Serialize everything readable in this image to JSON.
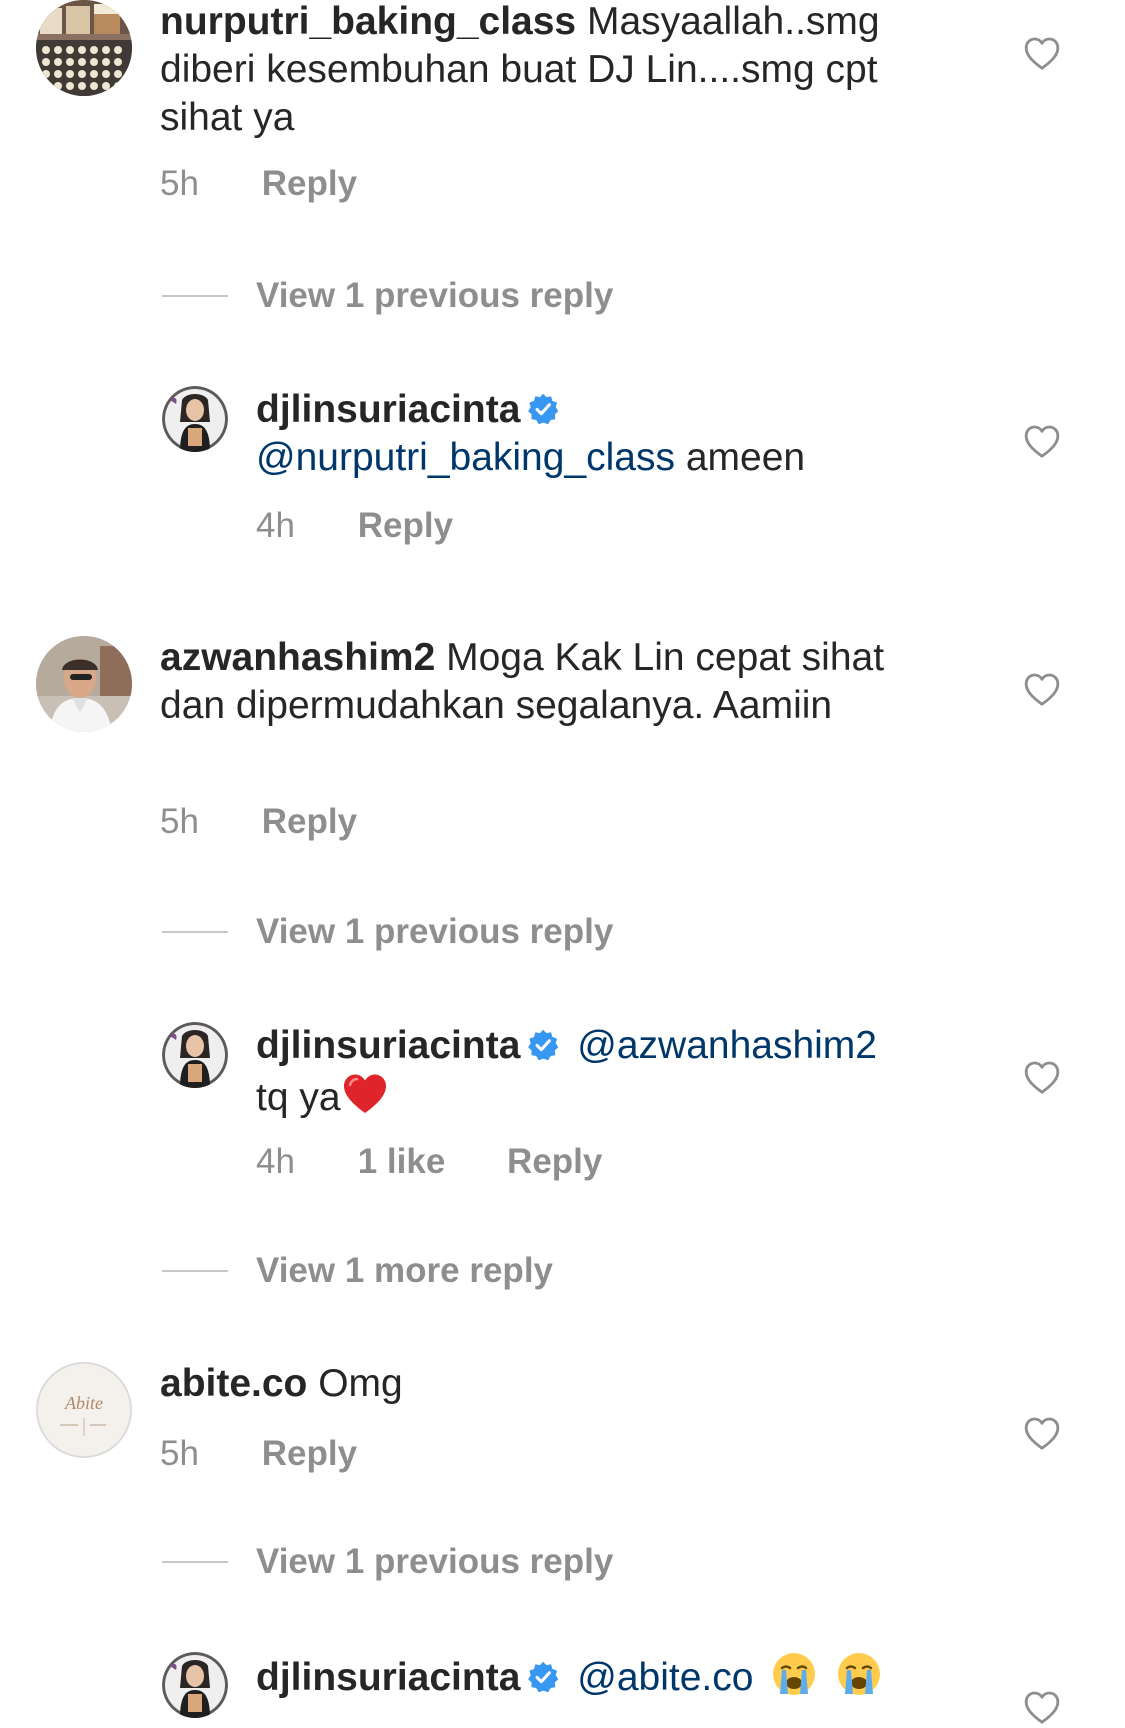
{
  "comments": [
    {
      "username": "nurputri_baking_class",
      "text": "Masyaallah..smg diberi kesembuhan buat DJ Lin....smg cpt sihat ya",
      "time": "5h",
      "reply_label": "Reply",
      "avatar_icon": "baking-cakes-avatar"
    },
    {
      "username": "djlinsuriacinta",
      "mention": "@nurputri_baking_class",
      "text": "ameen",
      "time": "4h",
      "reply_label": "Reply",
      "verified": true
    },
    {
      "username": "azwanhashim2",
      "text": "Moga Kak Lin cepat sihat dan dipermudahkan segalanya. Aamiin",
      "time": "5h",
      "reply_label": "Reply"
    },
    {
      "username": "djlinsuriacinta",
      "mention": "@azwanhashim2",
      "text": "tq ya",
      "emoji": "red-heart",
      "time": "4h",
      "likes": "1 like",
      "reply_label": "Reply",
      "verified": true
    },
    {
      "username": "abite.co",
      "text": "Omg",
      "time": "5h",
      "reply_label": "Reply",
      "avatar_logo": "Abite"
    },
    {
      "username": "djlinsuriacinta",
      "mention": "@abite.co",
      "emoji": "loudly-crying-face",
      "verified": true
    }
  ],
  "view_replies": [
    "View 1 previous reply",
    "View 1 previous reply",
    "View 1 more reply",
    "View 1 previous reply"
  ],
  "colors": {
    "text": "#262626",
    "secondary": "#8e8e8e",
    "mention": "#00376b",
    "verified": "#3897f0",
    "heart": "#ed4956"
  }
}
